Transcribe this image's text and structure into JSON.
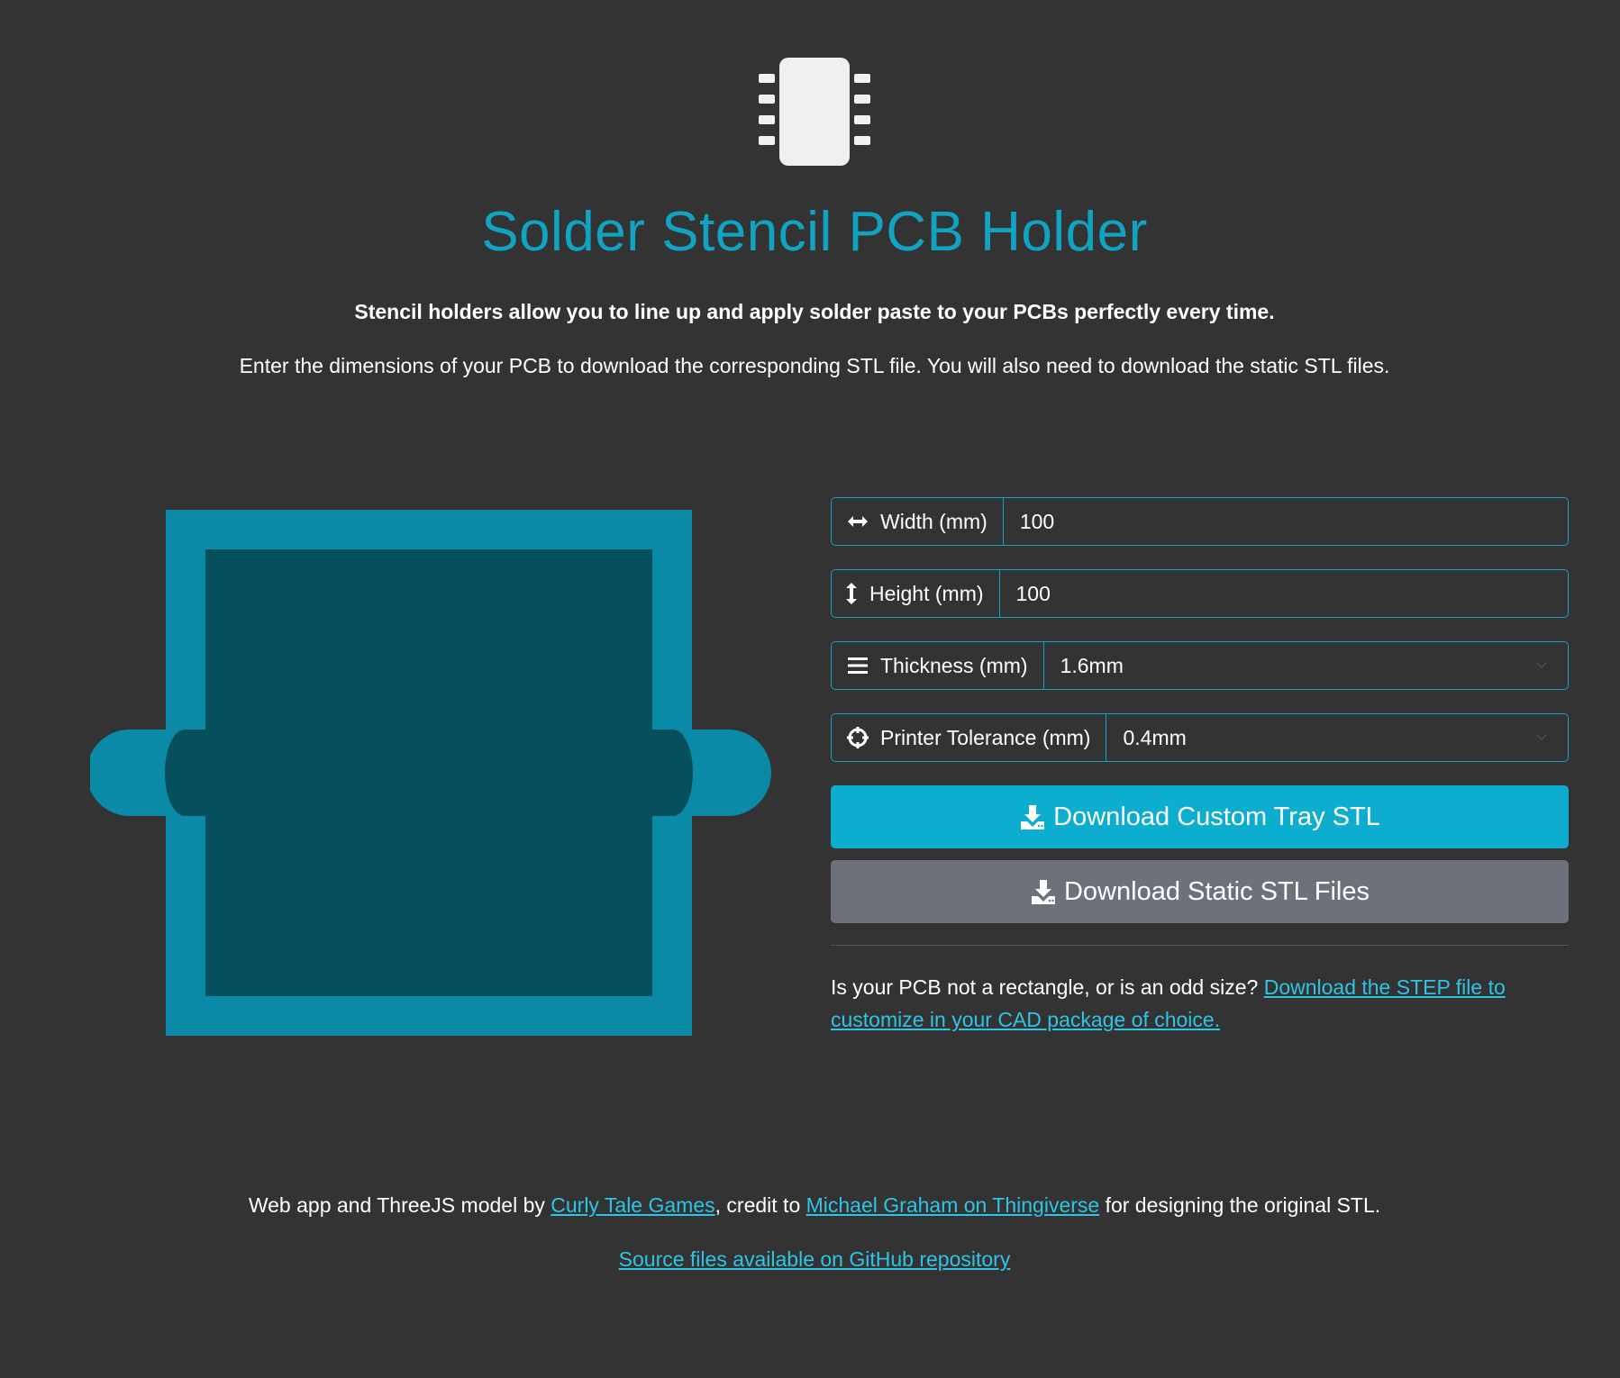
{
  "header": {
    "logo_icon": "microchip-icon",
    "title": "Solder Stencil PCB Holder",
    "lead": "Stencil holders allow you to line up and apply solder paste to your PCBs perfectly every time.",
    "subtitle": "Enter the dimensions of your PCB to download the corresponding STL file. You will also need to download the static STL files."
  },
  "preview": {
    "icon": "pcb-tray-preview",
    "colors": {
      "frame": "#0a8aa6",
      "inner": "#064f5c"
    }
  },
  "form": {
    "width": {
      "icon": "arrows-horizontal-icon",
      "label": "Width (mm)",
      "value": "100"
    },
    "height": {
      "icon": "arrows-vertical-icon",
      "label": "Height (mm)",
      "value": "100"
    },
    "thickness": {
      "icon": "bars-icon",
      "label": "Thickness (mm)",
      "value": "1.6mm"
    },
    "tolerance": {
      "icon": "crosshairs-icon",
      "label": "Printer Tolerance (mm)",
      "value": "0.4mm"
    }
  },
  "buttons": {
    "custom": {
      "icon": "download-icon",
      "label": "Download Custom Tray STL"
    },
    "static": {
      "icon": "download-icon",
      "label": "Download Static STL Files"
    }
  },
  "note": {
    "text": "Is your PCB not a rectangle, or is an odd size? ",
    "link": "Download the STEP file to customize in your CAD package of choice."
  },
  "footer": {
    "prefix": "Web app and ThreeJS model by ",
    "link1": "Curly Tale Games",
    "middle": ", credit to ",
    "link2": "Michael Graham on Thingiverse",
    "suffix": " for designing the original STL.",
    "source_link": "Source files available on GitHub repository"
  },
  "colors": {
    "background": "#333333",
    "accent": "#10a3c2",
    "primary_button": "#0dadcf",
    "secondary_button": "#6c717a",
    "link": "#2ec4e6"
  }
}
